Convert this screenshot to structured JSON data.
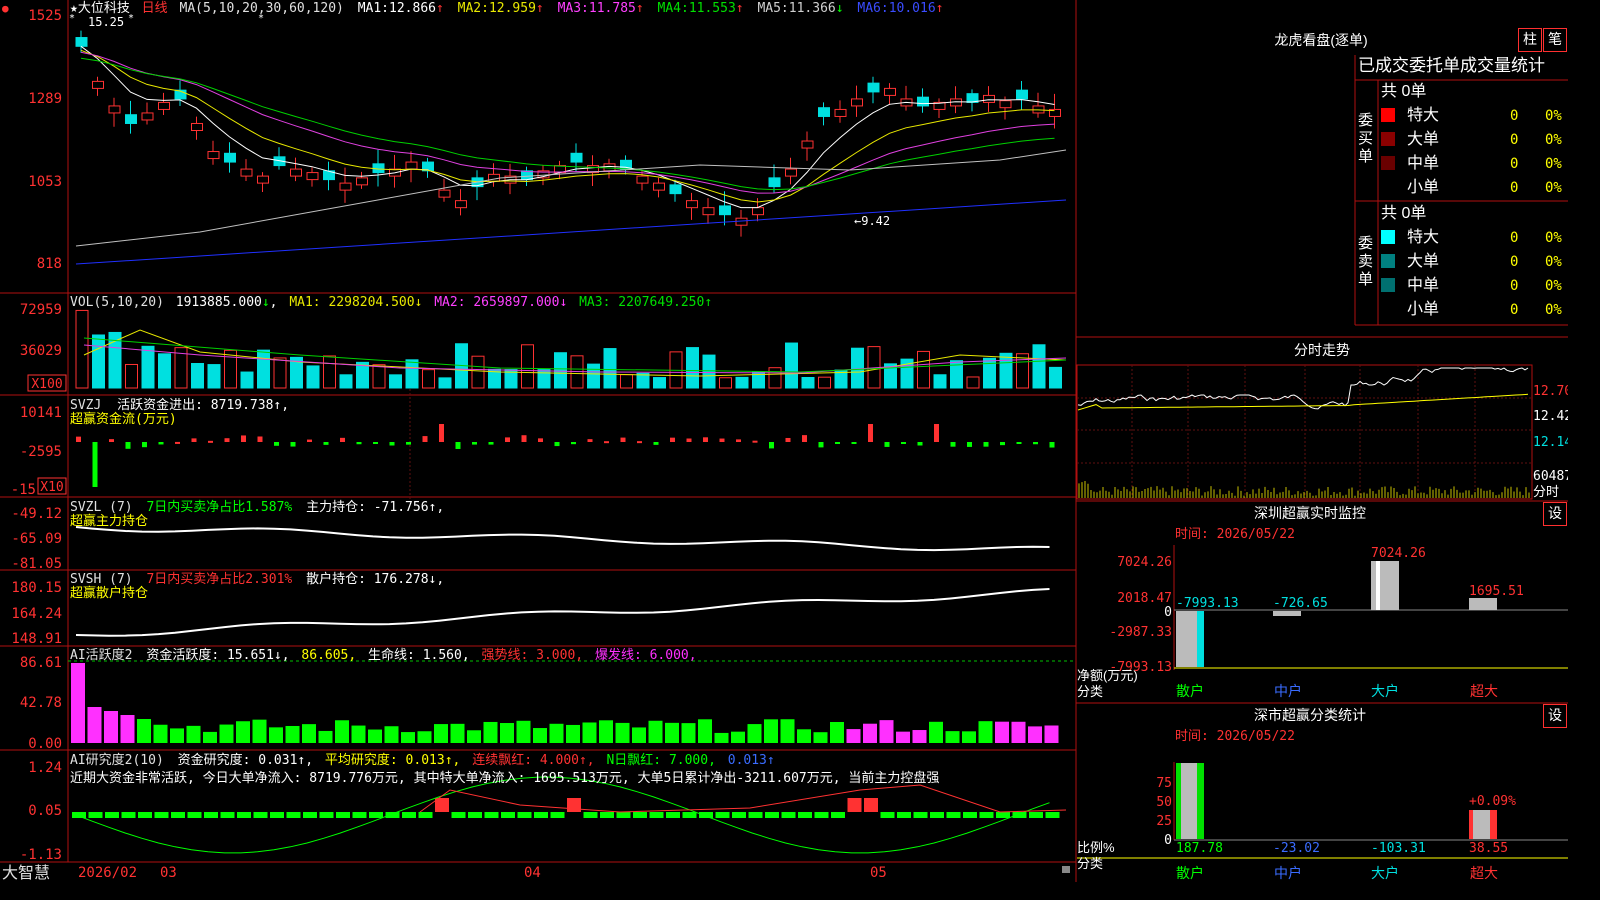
{
  "colors": {
    "up": "#ff3232",
    "down": "#00e0e0",
    "grid": "#b01010",
    "ma5": "#ffffff",
    "ma10": "#e8e800",
    "ma20": "#e040e0",
    "ma30": "#00d000",
    "ma60": "#c0c0c0",
    "ma120": "#2030ff",
    "green": "#00ff00",
    "magenta": "#ff30ff",
    "yellow": "#ffff00",
    "blue": "#3a6cff",
    "white": "#ffffff"
  },
  "main_panel": {
    "marker": "●",
    "stock_name": "★大位科技",
    "period": "日线",
    "ma_spec": "MA(5,10,20,30,60,120)",
    "ma_values": [
      {
        "label": "MA1:",
        "value": "12.866",
        "arrow": "↑"
      },
      {
        "label": "MA2:",
        "value": "12.959",
        "arrow": "↑"
      },
      {
        "label": "MA3:",
        "value": "11.785",
        "arrow": "↑"
      },
      {
        "label": "MA4:",
        "value": "11.553",
        "arrow": "↑"
      },
      {
        "label": "MA5:",
        "value": "11.366",
        "arrow": "↓"
      },
      {
        "label": "MA6:",
        "value": "10.016",
        "arrow": "↑"
      }
    ],
    "high_mark": "15.25",
    "low_mark": "←9.42",
    "yticks": [
      "1525",
      "1289",
      "1053",
      "818"
    ]
  },
  "vol_panel": {
    "title": "VOL(5,10,20)",
    "value": "1913885.000",
    "arrow": "↓",
    "ma1": "MA1: 2298204.500↓",
    "ma2": "MA2: 2659897.000↓",
    "ma3": "MA3: 2207649.250↑",
    "yticks": [
      "72959",
      "36029"
    ],
    "unit": "X100"
  },
  "svzj_panel": {
    "title": "SVZJ",
    "line": "活跃资金进出: 8719.738↑,",
    "subtitle": "超赢资金流(万元)",
    "yticks": [
      "10141",
      "-2595",
      "-15"
    ],
    "unit": "X10"
  },
  "svzl_panel": {
    "title": "SVZL (7)",
    "ratio": "7日内买卖净占比1.587%",
    "pos": "主力持仓: -71.756↑,",
    "subtitle": "超赢主力持仓",
    "yticks": [
      "-49.12",
      "-65.09",
      "-81.05"
    ]
  },
  "svsh_panel": {
    "title": "SVSH (7)",
    "ratio": "7日内买卖净占比2.301%",
    "pos": "散户持仓: 176.278↓,",
    "subtitle": "超赢散户持仓",
    "yticks": [
      "180.15",
      "164.24",
      "148.91"
    ]
  },
  "ai1_panel": {
    "title": "AI活跃度2",
    "a": "资金活跃度: 15.651↓,",
    "b": "86.605,",
    "c": "生命线: 1.560,",
    "d": "强势线: 3.000,",
    "e": "爆发线: 6.000,",
    "yticks": [
      "86.61",
      "42.78",
      "0.00"
    ]
  },
  "ai2_panel": {
    "title": "AI研究度2(10)",
    "a": "资金研究度: 0.031↑,",
    "b": "平均研究度: 0.013↑,",
    "c": "连续飘红: 4.000↑,",
    "d": "N日飘红: 7.000,",
    "e": "0.013↑",
    "text": "近期大资金非常活跃, 今日大单净流入: 8719.776万元, 其中特大单净流入: 1695.513万元, 大单5日累计净出-3211.607万元, 当前主力控盘强",
    "yticks": [
      "1.24",
      "0.05",
      "-1.13"
    ]
  },
  "bottom_bar": {
    "brand": "大智慧",
    "dates": [
      "2026/02",
      "03",
      "04",
      "05"
    ]
  },
  "right": {
    "title": "龙虎看盘(逐单)",
    "btn1": "柱",
    "btn2": "笔",
    "tabs": [
      "已成交",
      "委托单",
      "成交量统计"
    ],
    "buy_label": "委买单",
    "sell_label": "委卖单",
    "buy_total": "共 0单",
    "sell_total": "共 0单",
    "buy_rows": [
      {
        "name": "特大",
        "count": "0",
        "pct": "0%"
      },
      {
        "name": "大单",
        "count": "0",
        "pct": "0%"
      },
      {
        "name": "中单",
        "count": "0",
        "pct": "0%"
      },
      {
        "name": "小单",
        "count": "0",
        "pct": "0%"
      }
    ],
    "sell_rows": [
      {
        "name": "特大",
        "count": "0",
        "pct": "0%"
      },
      {
        "name": "大单",
        "count": "0",
        "pct": "0%"
      },
      {
        "name": "中单",
        "count": "0",
        "pct": "0%"
      },
      {
        "name": "小单",
        "count": "0",
        "pct": "0%"
      }
    ],
    "intraday_title": "分时走势",
    "intraday_yticks": [
      "12.70",
      "12.42",
      "12.14"
    ],
    "intraday_vol": "60487",
    "intraday_unit": "分时",
    "monitor_title": "深圳超赢实时监控",
    "monitor_btn": "设",
    "monitor_time": "时间: 2026/05/22",
    "monitor_yticks": [
      "7024.26",
      "2018.47",
      "0",
      "-2987.33",
      "-7993.13"
    ],
    "monitor_values": [
      "-7993.13",
      "-726.65",
      "7024.26",
      "1695.51"
    ],
    "monitor_side": [
      "净额(万元)",
      "分类"
    ],
    "categories": [
      "散户",
      "中户",
      "大户",
      "超大"
    ],
    "stat_title": "深市超赢分类统计",
    "stat_btn": "设",
    "stat_time": "时间: 2026/05/22",
    "stat_yticks": [
      "75",
      "50",
      "25",
      "0"
    ],
    "stat_values": [
      "187.78",
      "-23.02",
      "-103.31",
      "38.55"
    ],
    "stat_pct": "+0.09%",
    "stat_side": [
      "比例%",
      "分类"
    ]
  }
}
